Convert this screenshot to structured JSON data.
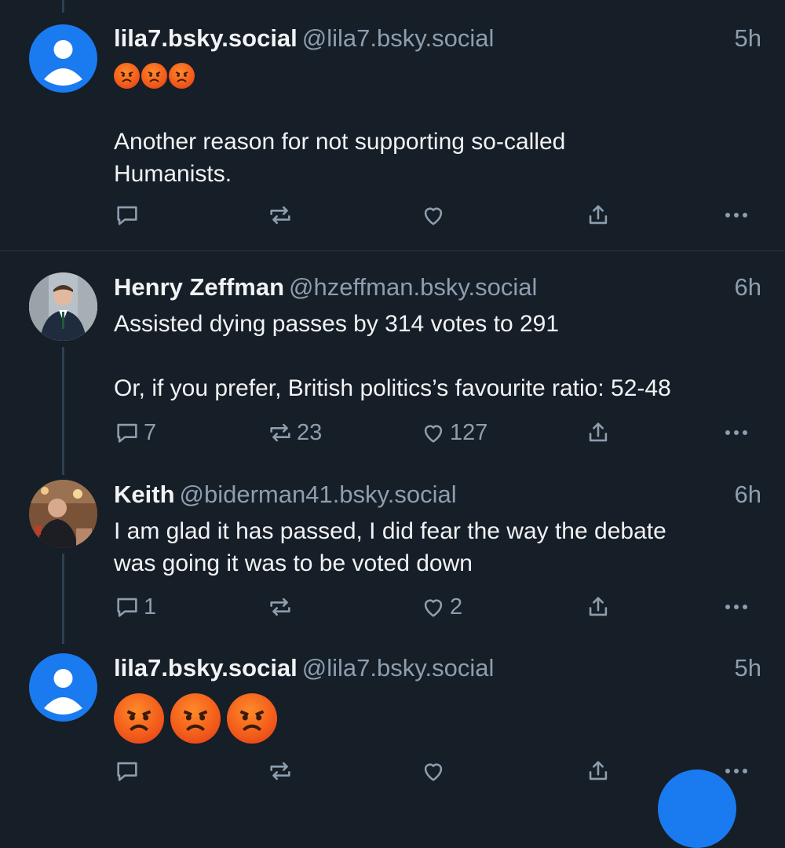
{
  "posts": [
    {
      "display_name": "lila7.bsky.social",
      "handle": "@lila7.bsky.social",
      "time": "5h",
      "emoji": [
        "angry-face",
        "angry-face",
        "angry-face"
      ],
      "text": "Another reason for not supporting so-called\nHumanists.",
      "replies": "",
      "reposts": "",
      "likes": ""
    },
    {
      "display_name": "Henry Zeffman",
      "handle": "@hzeffman.bsky.social",
      "time": "6h",
      "text": "Assisted dying passes by 314 votes to 291\n\nOr, if you prefer, British politics’s favourite ratio: 52-48",
      "replies": "7",
      "reposts": "23",
      "likes": "127"
    },
    {
      "display_name": "Keith",
      "handle": "@biderman41.bsky.social",
      "time": "6h",
      "text": "I am glad it has passed, I did fear the way the debate\nwas going it was to be voted down",
      "replies": "1",
      "reposts": "",
      "likes": "2"
    },
    {
      "display_name": "lila7.bsky.social",
      "handle": "@lila7.bsky.social",
      "time": "5h",
      "emoji": [
        "angry-face",
        "angry-face",
        "angry-face"
      ],
      "replies": "",
      "reposts": "",
      "likes": ""
    }
  ],
  "icons": {
    "reply": "reply-icon",
    "repost": "repost-icon",
    "like": "heart-icon",
    "share": "share-icon",
    "more": "more-icon",
    "avatar_default": "default-avatar-icon",
    "emoji": "angry-face-emoji"
  },
  "colors": {
    "background": "#161e27",
    "text": "#f1f3f5",
    "muted": "#8d9eb0",
    "thread_line": "#2e4052",
    "default_avatar": "#1a7af0",
    "accent": "#1a7af0"
  }
}
